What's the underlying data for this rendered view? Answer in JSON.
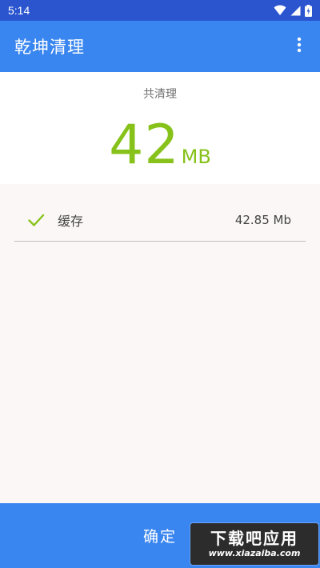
{
  "status_bar": {
    "time": "5:14",
    "icons": [
      "wifi-icon",
      "cellular-signal-icon",
      "battery-charging-icon"
    ]
  },
  "app_bar": {
    "title": "乾坤清理",
    "menu_icon": "more-vert-icon"
  },
  "summary": {
    "label": "共清理",
    "amount": "42",
    "unit": "MB"
  },
  "cleaned_items": [
    {
      "label": "缓存",
      "size": "42.85 Mb",
      "checked": true
    }
  ],
  "footer": {
    "confirm_label": "确定"
  },
  "watermark": {
    "main": "下载吧应用",
    "sub": "www.xiazaiba.com"
  },
  "colors": {
    "status_bar": "#2b55cf",
    "app_bar": "#3a86f0",
    "accent_green": "#86c21a",
    "list_background": "#fbf7f6"
  }
}
